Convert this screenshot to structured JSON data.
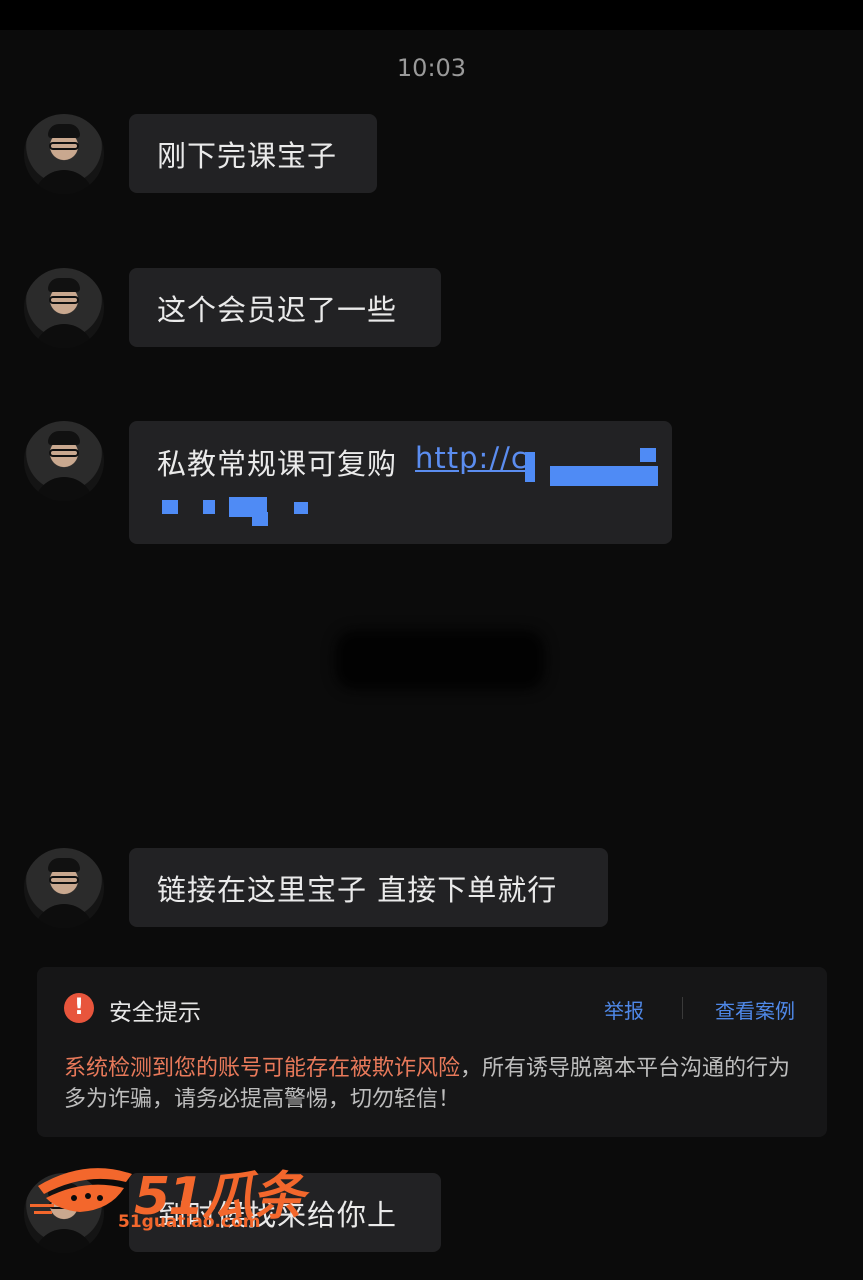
{
  "timestamp": "10:03",
  "messages": [
    {
      "text": "刚下完课宝子"
    },
    {
      "text": "这个会员迟了一些"
    },
    {
      "text": "私教常规课可复购",
      "link": "http://c"
    },
    {
      "text": "链接在这里宝子 直接下单就行"
    },
    {
      "text": "到时候找来给你上"
    }
  ],
  "security_alert": {
    "icon": "exclamation-icon",
    "title": "安全提示",
    "report_label": "举报",
    "view_cases_label": "查看案例",
    "warning_text": "系统检测到您的账号可能存在被欺诈风险",
    "body_text": "，所有诱导脱离本平台沟通的行为多为诈骗，请务必提高警惕，切勿轻信！"
  },
  "watermark": {
    "brand": "51瓜条",
    "url": "51guatiao.com"
  },
  "colors": {
    "background": "#0b0b0b",
    "bubble": "#222224",
    "link": "#5b8df0",
    "warning": "#e8795a",
    "alert_icon": "#e8553c",
    "watermark": "#f3672c"
  }
}
